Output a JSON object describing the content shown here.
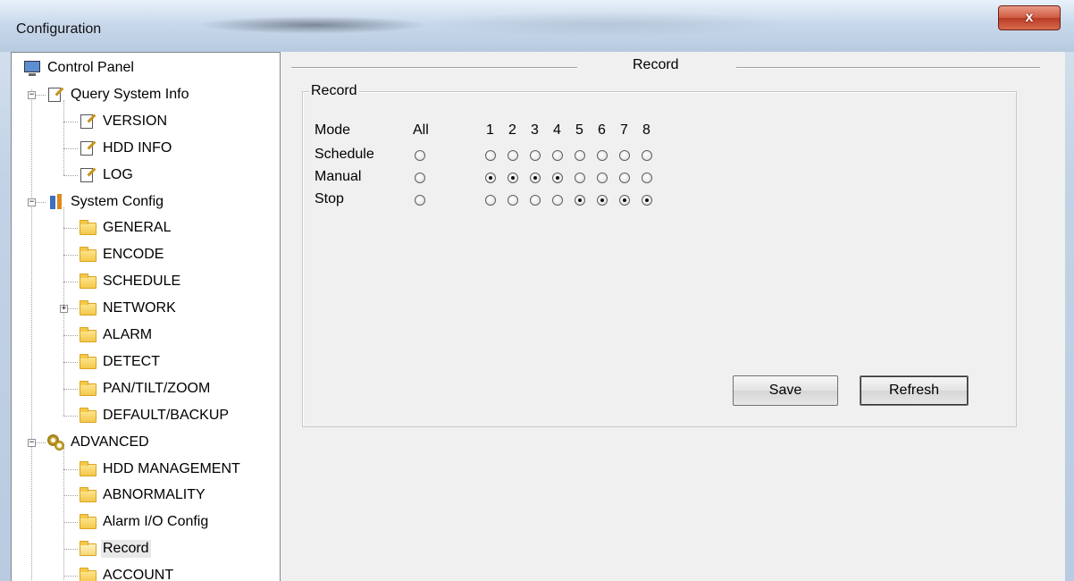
{
  "window": {
    "title": "Configuration",
    "close_label": "x"
  },
  "tree": {
    "items": [
      {
        "label": "Control Panel",
        "icon": "monitor-icon"
      },
      {
        "label": "Query System Info",
        "icon": "edit-icon"
      },
      {
        "label": "VERSION",
        "icon": "edit-icon"
      },
      {
        "label": "HDD INFO",
        "icon": "edit-icon"
      },
      {
        "label": "LOG",
        "icon": "edit-icon"
      },
      {
        "label": "System Config",
        "icon": "tools-icon"
      },
      {
        "label": "GENERAL",
        "icon": "folder-icon"
      },
      {
        "label": "ENCODE",
        "icon": "folder-icon"
      },
      {
        "label": "SCHEDULE",
        "icon": "folder-icon"
      },
      {
        "label": "NETWORK",
        "icon": "folder-icon"
      },
      {
        "label": "ALARM",
        "icon": "folder-icon"
      },
      {
        "label": "DETECT",
        "icon": "folder-icon"
      },
      {
        "label": "PAN/TILT/ZOOM",
        "icon": "folder-icon"
      },
      {
        "label": "DEFAULT/BACKUP",
        "icon": "folder-icon"
      },
      {
        "label": "ADVANCED",
        "icon": "gears-icon"
      },
      {
        "label": "HDD MANAGEMENT",
        "icon": "folder-icon"
      },
      {
        "label": "ABNORMALITY",
        "icon": "folder-icon"
      },
      {
        "label": "Alarm I/O Config",
        "icon": "folder-icon"
      },
      {
        "label": "Record",
        "icon": "folder-open-icon"
      },
      {
        "label": "ACCOUNT",
        "icon": "folder-icon"
      }
    ],
    "expander_minus": "−",
    "expander_plus": "+"
  },
  "panel": {
    "title": "Record",
    "group_label": "Record",
    "header_label": "Mode",
    "columns": [
      "All",
      "1",
      "2",
      "3",
      "4",
      "5",
      "6",
      "7",
      "8"
    ],
    "rows": [
      {
        "label": "Schedule",
        "checked": [
          false,
          false,
          false,
          false,
          false,
          false,
          false,
          false,
          false
        ]
      },
      {
        "label": "Manual",
        "checked": [
          false,
          true,
          true,
          true,
          true,
          false,
          false,
          false,
          false
        ]
      },
      {
        "label": "Stop",
        "checked": [
          false,
          false,
          false,
          false,
          false,
          true,
          true,
          true,
          true
        ]
      }
    ],
    "save_label": "Save",
    "refresh_label": "Refresh"
  }
}
